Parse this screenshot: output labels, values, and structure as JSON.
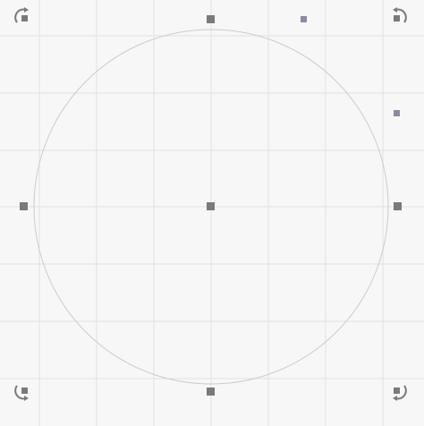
{
  "canvas": {
    "background": "#f7f7f7",
    "grid_color": "#e2e2e2",
    "grid": true
  },
  "shape": {
    "type": "circle",
    "stroke": "#cccccc",
    "fill": "none",
    "selected": true
  },
  "handles": {
    "color": "#7a7a7a",
    "secondary_color": "#8a8aa0",
    "resize": [
      "top",
      "left",
      "right",
      "bottom",
      "center"
    ],
    "rotate": [
      "top-left-rotate-handle",
      "top-right-rotate-handle",
      "bottom-left-rotate-handle",
      "bottom-right-rotate-handle"
    ],
    "extra": [
      "top-right-extra-handle",
      "right-extra-handle"
    ],
    "rotate_icon": "rotate-arrow-icon"
  }
}
